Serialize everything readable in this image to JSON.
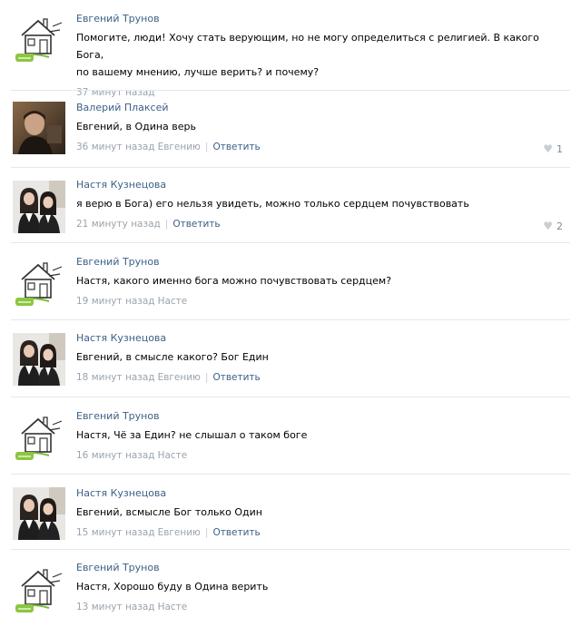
{
  "comments": [
    {
      "author": "Евгений Трунов",
      "avatar": "house-sketch",
      "text_lines": [
        "Помогите, люди! Хочу стать верующим, но не могу определиться с религией. В какого Бога,",
        "по вашему мнению, лучше верить? и почему?"
      ],
      "time": "37 минут назад",
      "reply_to": "",
      "reply_label": "",
      "likes": ""
    },
    {
      "author": "Валерий Плаксей",
      "avatar": "man-photo",
      "text_lines": [
        "Евгений, в Одина верь"
      ],
      "time": "36 минут назад",
      "reply_to": "Евгению",
      "reply_label": "Ответить",
      "likes": "1"
    },
    {
      "author": "Настя Кузнецова",
      "avatar": "girls-photo",
      "text_lines": [
        "я верю в Бога) его нельзя увидеть, можно только сердцем почувствовать"
      ],
      "time": "21 минуту назад",
      "reply_to": "",
      "reply_label": "Ответить",
      "likes": "2"
    },
    {
      "author": "Евгений Трунов",
      "avatar": "house-sketch",
      "text_lines": [
        "Настя, какого именно бога можно почувствовать сердцем?"
      ],
      "time": "19 минут назад",
      "reply_to": "Насте",
      "reply_label": "",
      "likes": ""
    },
    {
      "author": "Настя Кузнецова",
      "avatar": "girls-photo",
      "text_lines": [
        "Евгений, в смысле какого? Бог Един"
      ],
      "time": "18 минут назад",
      "reply_to": "Евгению",
      "reply_label": "Ответить",
      "likes": ""
    },
    {
      "author": "Евгений Трунов",
      "avatar": "house-sketch",
      "text_lines": [
        "Настя, Чё за Един? не слышал о таком боге"
      ],
      "time": "16 минут назад",
      "reply_to": "Насте",
      "reply_label": "",
      "likes": ""
    },
    {
      "author": "Настя Кузнецова",
      "avatar": "girls-photo",
      "text_lines": [
        "Евгений, всмысле Бог только Один"
      ],
      "time": "15 минут назад",
      "reply_to": "Евгению",
      "reply_label": "Ответить",
      "likes": ""
    },
    {
      "author": "Евгений Трунов",
      "avatar": "house-sketch",
      "text_lines": [
        "Настя, Хорошо буду в Одина верить"
      ],
      "time": "13 минут назад",
      "reply_to": "Насте",
      "reply_label": "",
      "likes": ""
    }
  ],
  "colors": {
    "author": "#3b5f86",
    "meta": "#9aa4ad",
    "divider": "#e3e8ee"
  }
}
